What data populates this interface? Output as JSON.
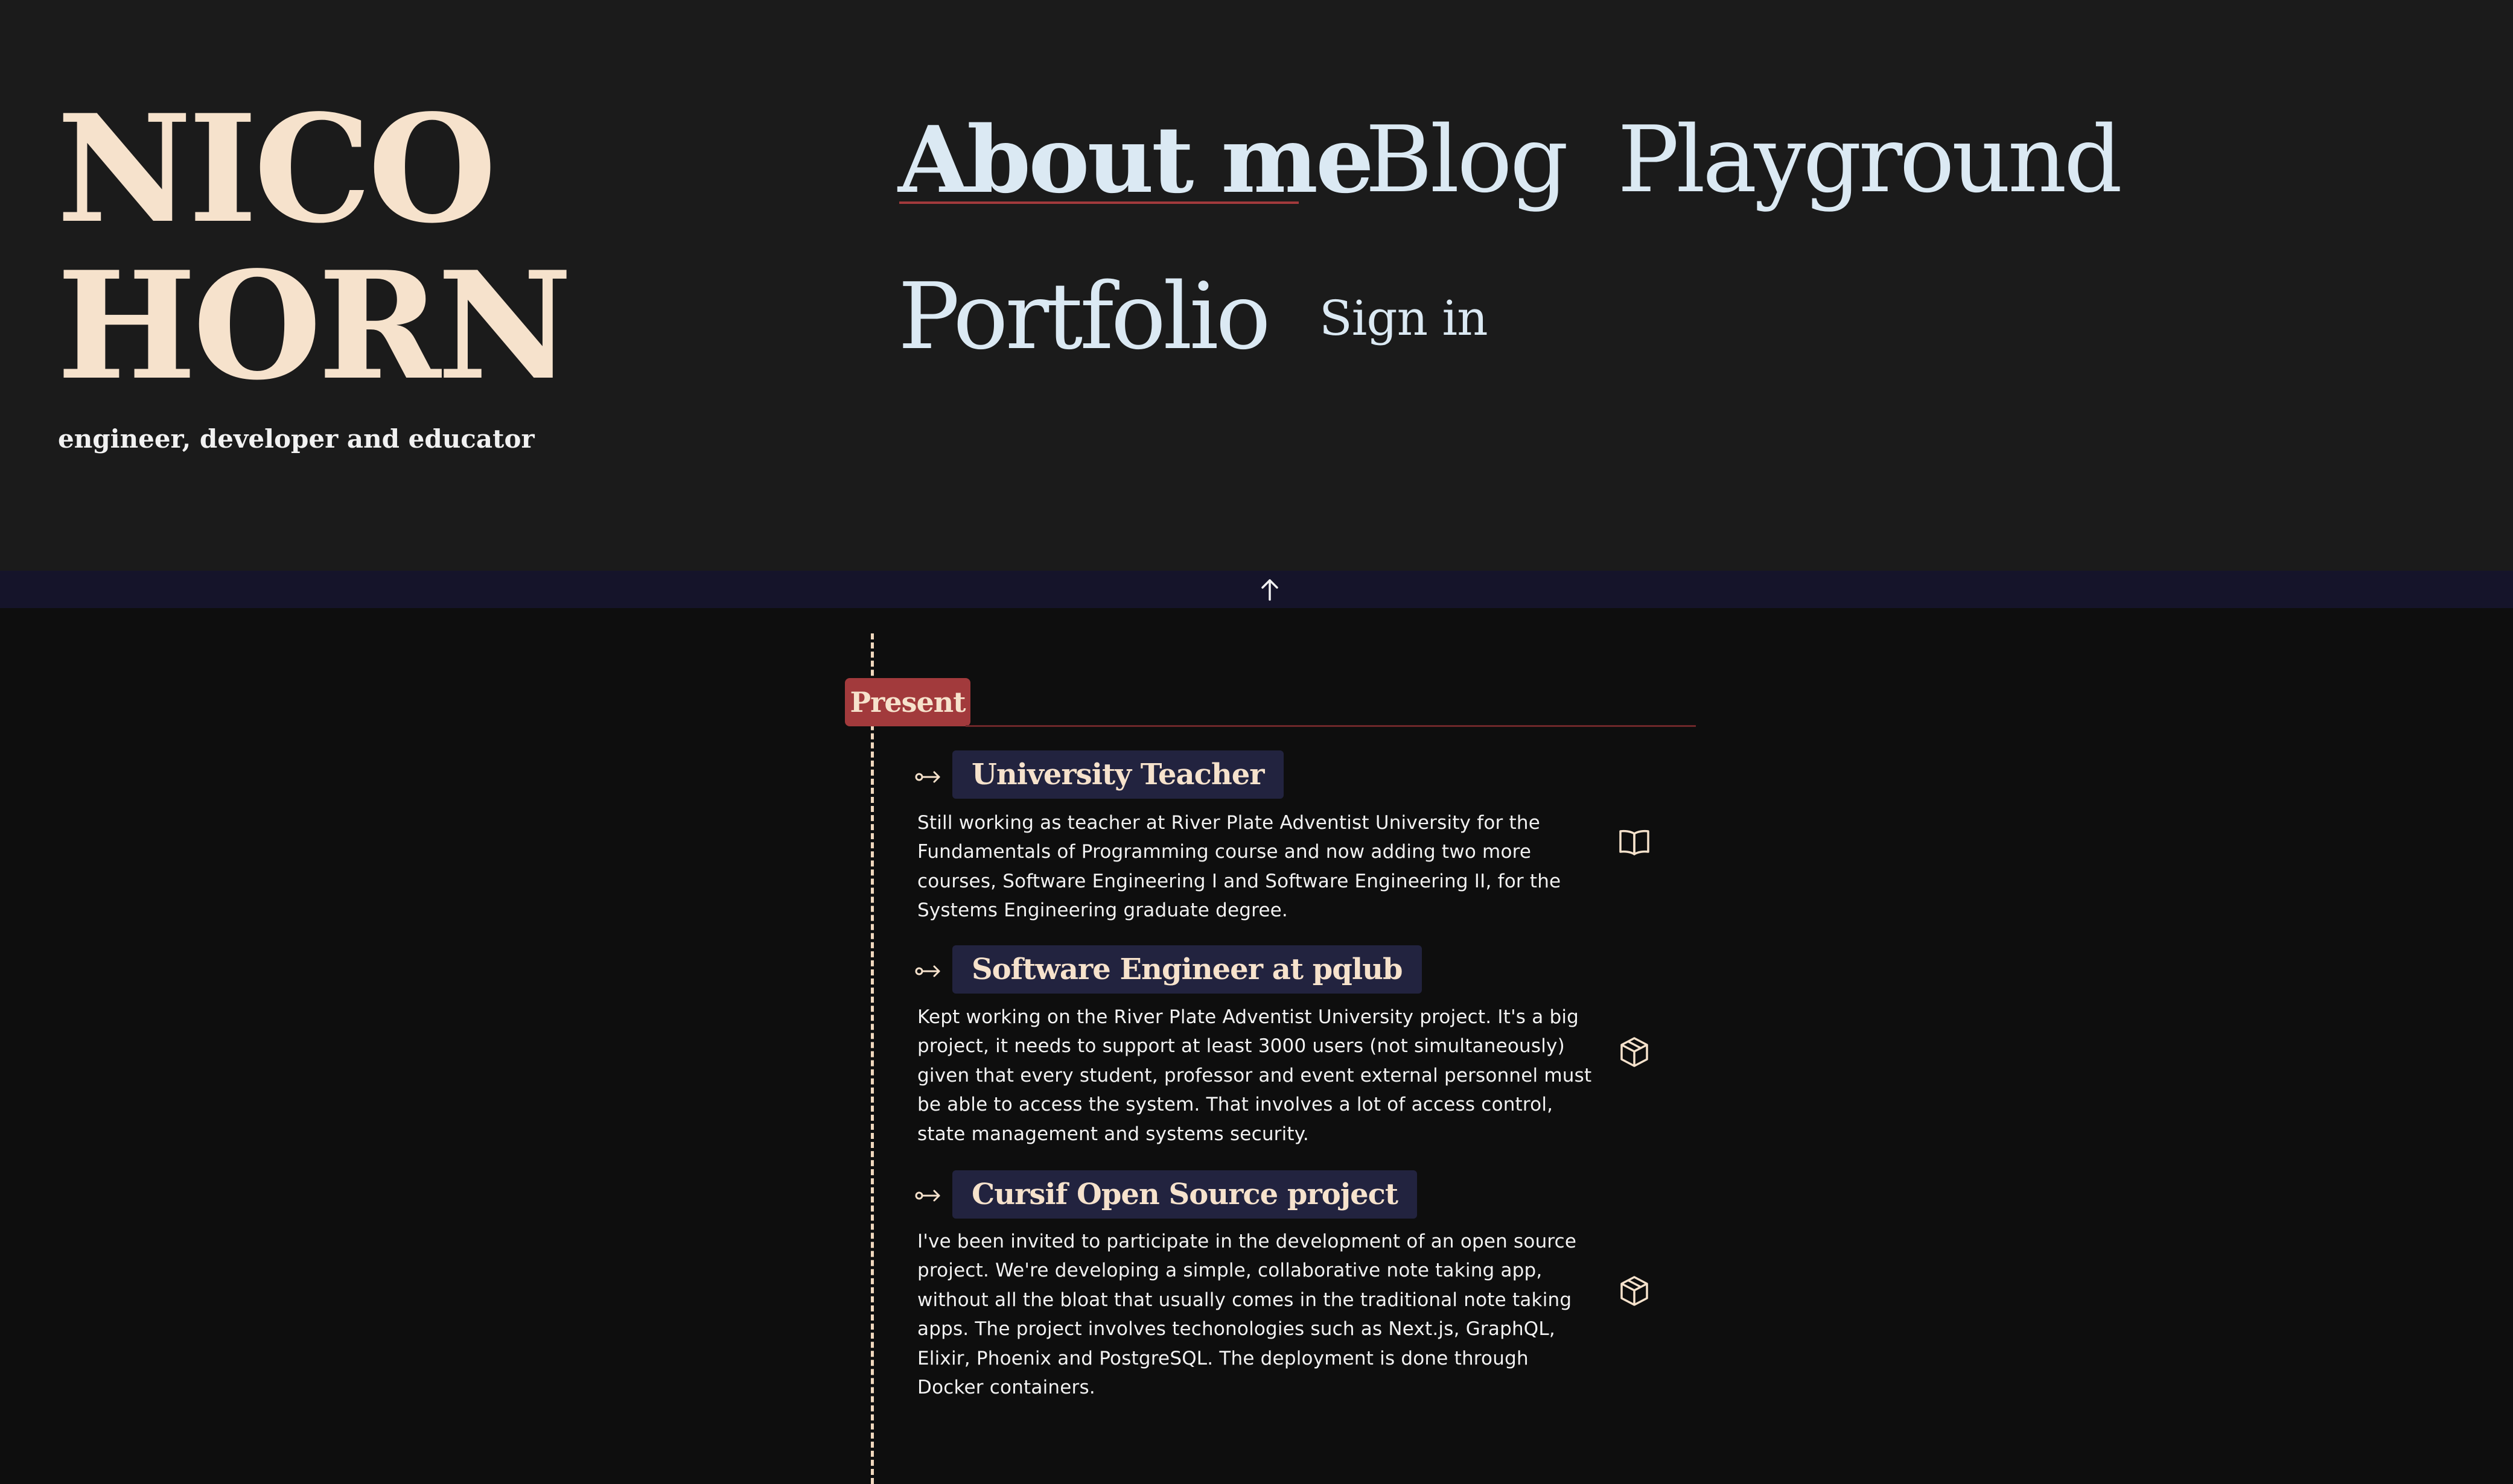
{
  "brand": {
    "name_line1": "NICO",
    "name_line2": "HORN",
    "tagline": "engineer, developer and educator"
  },
  "nav": {
    "about": "About me",
    "blog": "Blog",
    "playground": "Playground",
    "portfolio": "Portfolio",
    "sign_in": "Sign in"
  },
  "scroll_top": {
    "icon": "arrow-up-icon"
  },
  "timeline": {
    "badge": "Present",
    "entries": [
      {
        "title": "University Teacher",
        "description": "Still working as teacher at River Plate Adventist University for the Fundamentals of Programming course and now adding two more courses, Software Engineering I and Software Engineering II, for the Systems Engineering graduate degree.",
        "icon": "book-icon",
        "arrow": "key-arrow-icon"
      },
      {
        "title": "Software Engineer at pqlub",
        "description": "Kept working on the River Plate Adventist University project. It's a big project, it needs to support at least 3000 users (not simultaneously) given that every student, professor and event external personnel must be able to access the system. That involves a lot of access control, state management and systems security.",
        "icon": "package-icon",
        "arrow": "key-arrow-icon"
      },
      {
        "title": "Cursif Open Source project",
        "description": "I've been invited to participate in the development of an open source project. We're developing a simple, collaborative note taking app, without all the bloat that usually comes in the traditional note taking apps. The project involves techonologies such as Next.js, GraphQL, Elixir, Phoenix and PostgreSQL. The deployment is done through Docker containers.",
        "icon": "package-icon",
        "arrow": "key-arrow-icon"
      }
    ]
  },
  "colors": {
    "header_bg": "#1b1b1b",
    "page_bg": "#0e0e0e",
    "logo": "#f6e2cc",
    "nav_text": "#dbe9f3",
    "accent_red": "#a23a3c",
    "title_bg": "#22233f",
    "scroll_bar_bg": "#15142a"
  }
}
